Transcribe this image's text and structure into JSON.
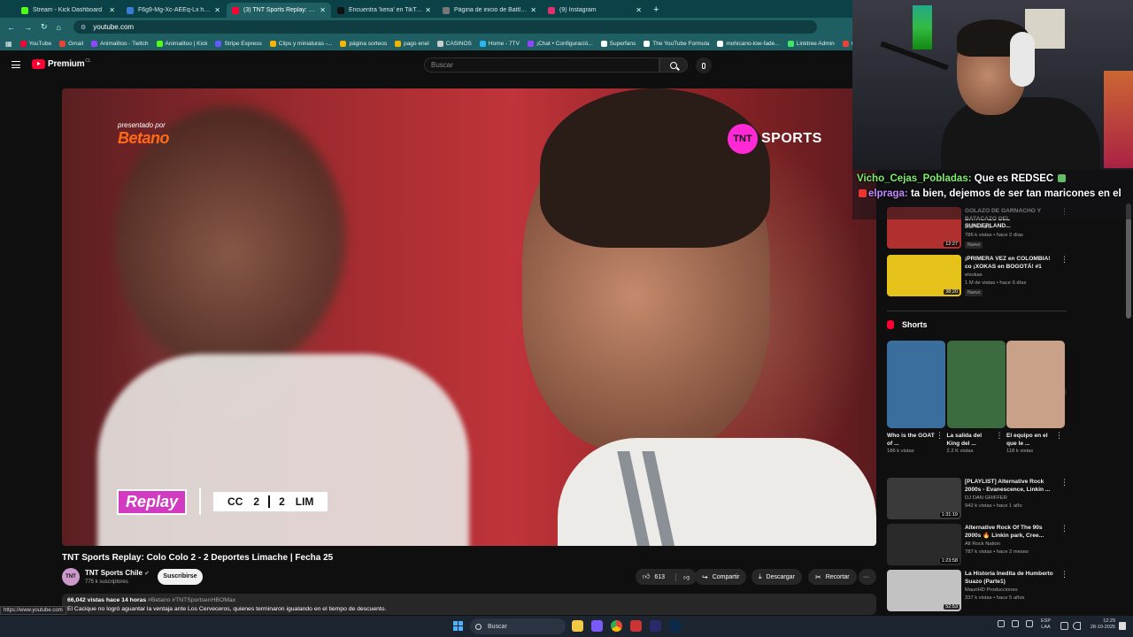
{
  "browser": {
    "tabs": [
      {
        "title": "Stream - Kick Dashboard",
        "color": "#53fc18",
        "active": false
      },
      {
        "title": "F6g9-Mg-Xc-AEEq-Lx hosted a",
        "color": "#3a7bd5",
        "active": false
      },
      {
        "title": "(3) TNT Sports Replay: Colo Col",
        "color": "#ff0033",
        "active": true
      },
      {
        "title": "Encuentra 'keria' en TikTok | Bu",
        "color": "#111111",
        "active": false
      },
      {
        "title": "Página de inicio de Battlefield™",
        "color": "#777777",
        "active": false
      },
      {
        "title": "(9) Instagram",
        "color": "#e1306c",
        "active": false
      }
    ],
    "new_tab": "+",
    "url": "youtube.com",
    "bookmarks": [
      {
        "label": "YouTube",
        "color": "#ff0033"
      },
      {
        "label": "Gmail",
        "color": "#ea4335"
      },
      {
        "label": "Animalitoo - Twitch",
        "color": "#9146ff"
      },
      {
        "label": "Animalitoo | Kick",
        "color": "#53fc18"
      },
      {
        "label": "Stripe Express",
        "color": "#635bff"
      },
      {
        "label": "Clips y miniaturas -...",
        "color": "#f4b400"
      },
      {
        "label": "página sorteos",
        "color": "#f4b400"
      },
      {
        "label": "pago enel",
        "color": "#f4b400"
      },
      {
        "label": "CASINOS",
        "color": "#cccccc"
      },
      {
        "label": "Home - 7TV",
        "color": "#29b6f6"
      },
      {
        "label": "¡Chat • Configuració...",
        "color": "#9146ff"
      },
      {
        "label": "Superfans",
        "color": "#ffffff"
      },
      {
        "label": "The YouTube Formula",
        "color": "#ffffff"
      },
      {
        "label": "mohicano-low-fade...",
        "color": "#ffffff"
      },
      {
        "label": "Linktree Admin",
        "color": "#43e660"
      },
      {
        "label": "Cálculo de Bo",
        "color": "#ea4335"
      }
    ]
  },
  "header": {
    "logo_text": "Premium",
    "logo_region": "CL",
    "search_placeholder": "Buscar"
  },
  "video": {
    "sponsor_pre": "presentado por",
    "sponsor": "Betano",
    "network_badge": "TNT",
    "network": "SPORTS",
    "replay_tag": "Replay",
    "home_team": "CC",
    "home_score": "2",
    "away_score": "2",
    "away_team": "LIM"
  },
  "info": {
    "title": "TNT Sports Replay: Colo Colo 2 - 2 Deportes Limache | Fecha 25",
    "channel": "TNT Sports Chile",
    "channel_avatar": "TNT",
    "subscribers": "775 k suscriptores",
    "subscribe": "Suscribirse",
    "likes": "613",
    "share": "Compartir",
    "download": "Descargar",
    "clip": "Recortar",
    "more": "···",
    "desc_stats": "66,042 vistas  hace 14 horas",
    "desc_tags": "#Betano #TNTSportsenHBOMax",
    "desc_text": "El Cacique no logró aguantar la ventaja ante Los Cerveceros, quienes terminaron igualando en el tiempo de descuento.",
    "status_url": "https://www.youtube.com"
  },
  "chat": {
    "line1_user": "Vicho_Cejas_Pobladas:",
    "line1_msg": "Que es REDSEC",
    "line2_user": "elpraga:",
    "line2_msg": "ta bien, dejemos de ser tan maricones en el"
  },
  "sidebar": {
    "recs_top": [
      {
        "title": "GOLAZO DE GARNACHO Y BATACAZO DEL SUNDERLAND...",
        "channel": "ESPN Fans",
        "meta": "786 k vistas • hace 2 días",
        "badge": "Nuevo",
        "duration": "12:27",
        "thumb": "#b03030"
      },
      {
        "title": "¡PRIMERA VEZ en COLOMBIA! co ¡XOKAS en BOGOTÁ! #1",
        "channel": "elxokas",
        "meta": "1 M de vistas • hace 6 días",
        "badge": "Nuevo",
        "duration": "38:20",
        "thumb": "#e4c21a"
      }
    ],
    "shorts_title": "Shorts",
    "shorts": [
      {
        "title": "Who is the GOAT of ...",
        "views": "186 k vistas",
        "thumb": "#3a6e9c"
      },
      {
        "title": "La salida del King del ...",
        "views": "2.2 K vistas",
        "thumb": "#3b6b3f"
      },
      {
        "title": "El equipo en el que le ...",
        "views": "118 k vistas",
        "thumb": "#c9a188"
      }
    ],
    "recs_bottom": [
      {
        "title": "[PLAYLIST] Alternative Rock 2000s - Evanescence, Linkin ...",
        "channel": "DJ DAN GRIFFER",
        "meta": "942 k vistas • hace 1 año",
        "duration": "1:31:19",
        "thumb": "#3a3a3a"
      },
      {
        "title": "Alternative Rock Of The 90s 2000s 🔥 Linkin park, Cree...",
        "channel": "Alt Rock Nation",
        "meta": "787 k vistas • hace 2 meses",
        "duration": "1:23:58",
        "thumb": "#2a2a2a"
      },
      {
        "title": "La Historia Inedita de Humberto Suazo (Parte1)",
        "channel": "MauriHD Producciones",
        "meta": "337 k vistas • hace 5 años",
        "duration": "52:53",
        "thumb": "#c2c2c2"
      }
    ]
  },
  "taskbar": {
    "search": "Buscar",
    "lang": "ESP",
    "lang2": "LAA",
    "time": "12:29",
    "date": "28-10-2025"
  }
}
